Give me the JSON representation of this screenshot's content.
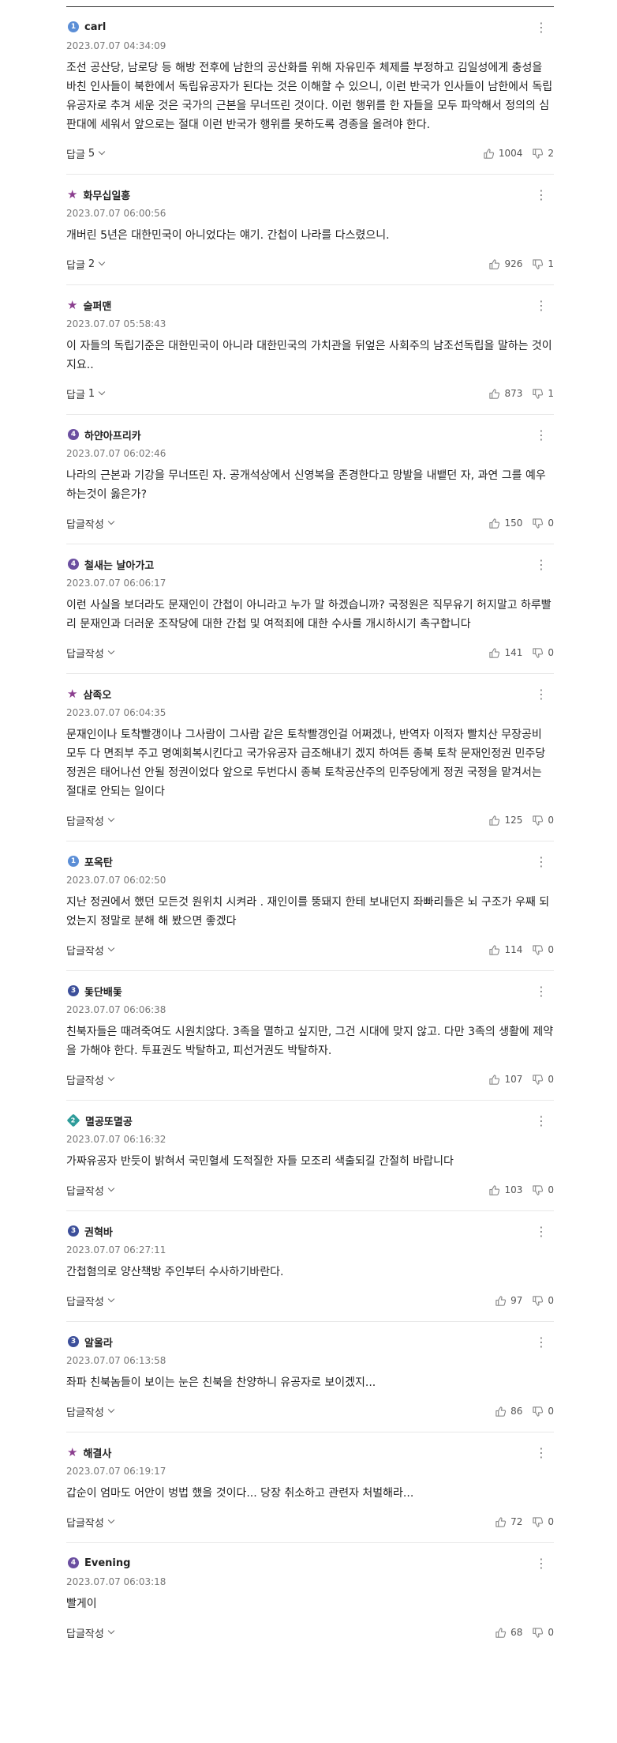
{
  "colors": {
    "badge_blue": "#5b8ed6",
    "badge_purple": "#6b4fa0",
    "badge_navy": "#3c4f9a",
    "badge_teal": "#2e9c9a",
    "star_purple": "#8b3f8f"
  },
  "comments": [
    {
      "author": "carl",
      "badge": {
        "shape": "circle",
        "level": "1",
        "color": "#5b8ed6"
      },
      "date": "2023.07.07 04:34:09",
      "text": "조선 공산당, 남로당 등 해방 전후에 남한의 공산화를 위해 자유민주 체제를 부정하고 김일성에게 충성을 바친 인사들이 북한에서 독립유공자가 된다는 것은 이해할 수 있으니, 이런 반국가 인사들이 남한에서 독립유공자로 추겨 세운 것은 국가의 근본을 무너뜨린 것이다. 이런 행위를 한 자들을 모두 파악해서 정의의 심판대에 세워서 앞으로는 절대 이런 반국가 행위를 못하도록 경종을 올려야 한다.",
      "reply_label": "답글",
      "reply_count": "5",
      "likes": "1004",
      "dislikes": "2"
    },
    {
      "author": "화무십일홍",
      "badge": {
        "shape": "star",
        "level": "5",
        "color": "#8b3f8f"
      },
      "date": "2023.07.07 06:00:56",
      "text": "개버린 5년은 대한민국이 아니었다는 얘기. 간첩이 나라를 다스렸으니.",
      "reply_label": "답글",
      "reply_count": "2",
      "likes": "926",
      "dislikes": "1"
    },
    {
      "author": "술퍼맨",
      "badge": {
        "shape": "star",
        "level": "5",
        "color": "#8b3f8f"
      },
      "date": "2023.07.07 05:58:43",
      "text": "이 자들의 독립기준은 대한민국이 아니라 대한민국의 가치관을 뒤엎은 사회주의 남조선독립을 말하는 것이지요..",
      "reply_label": "답글",
      "reply_count": "1",
      "likes": "873",
      "dislikes": "1"
    },
    {
      "author": "하얀아프리카",
      "badge": {
        "shape": "circle",
        "level": "4",
        "color": "#6b4fa0"
      },
      "date": "2023.07.07 06:02:46",
      "text": "나라의 근본과 기강을 무너뜨린 자. 공개석상에서 신영복을 존경한다고 망발을 내뱉던 자, 과연 그를 예우하는것이 옳은가?",
      "reply_label": "답글작성",
      "reply_count": "",
      "likes": "150",
      "dislikes": "0"
    },
    {
      "author": "철새는 날아가고",
      "badge": {
        "shape": "circle",
        "level": "4",
        "color": "#6b4fa0"
      },
      "date": "2023.07.07 06:06:17",
      "text": "이런 사실을 보더라도 문재인이 간첩이 아니라고 누가 말 하겠습니까? 국정원은 직무유기 허지말고 하루빨리 문재인과 더러운 조작당에 대한 간첩 및 여적죄에 대한 수사를 개시하시기 촉구합니다",
      "reply_label": "답글작성",
      "reply_count": "",
      "likes": "141",
      "dislikes": "0"
    },
    {
      "author": "삼족오",
      "badge": {
        "shape": "star",
        "level": "5",
        "color": "#8b3f8f"
      },
      "date": "2023.07.07 06:04:35",
      "text": "문재인이나 토착빨갱이나 그사람이 그사람 같은 토착빨갱인걸 어쩌겠나, 반역자 이적자 빨치산 무장공비 모두 다 면죄부 주고 명예회복시킨다고 국가유공자 급조해내기 겠지 하여튼 종북 토착 문재인정권 민주당정권은 태어나선 안될 정권이었다 앞으로 두번다시 종북 토착공산주의 민주당에게 정권 국정을 맡겨서는 절대로 안되는 일이다",
      "reply_label": "답글작성",
      "reply_count": "",
      "likes": "125",
      "dislikes": "0"
    },
    {
      "author": "포옥탄",
      "badge": {
        "shape": "circle",
        "level": "1",
        "color": "#5b8ed6"
      },
      "date": "2023.07.07 06:02:50",
      "text": "지난 정권에서 했던 모든것 원위치 시켜라 . 재인이를 뚱돼지 한테 보내던지 좌빠리들은 뇌 구조가 우째 되었는지 정말로 분해 해 봤으면 좋겠다",
      "reply_label": "답글작성",
      "reply_count": "",
      "likes": "114",
      "dislikes": "0"
    },
    {
      "author": "돛단배돛",
      "badge": {
        "shape": "circle",
        "level": "3",
        "color": "#3c4f9a"
      },
      "date": "2023.07.07 06:06:38",
      "text": "친북자들은 때려죽여도 시원치않다. 3족을 멸하고 싶지만, 그건 시대에 맞지 않고. 다만 3족의 생활에 제약을 가해야 한다. 투표권도 박탈하고, 피선거권도 박탈하자.",
      "reply_label": "답글작성",
      "reply_count": "",
      "likes": "107",
      "dislikes": "0"
    },
    {
      "author": "멸공또멸공",
      "badge": {
        "shape": "diamond",
        "level": "2",
        "color": "#2e9c9a"
      },
      "date": "2023.07.07 06:16:32",
      "text": "가짜유공자 반듯이 밝혀서 국민혈세 도적질한 자들 모조리 색출되길 간절히 바랍니다",
      "reply_label": "답글작성",
      "reply_count": "",
      "likes": "103",
      "dislikes": "0"
    },
    {
      "author": "권혁바",
      "badge": {
        "shape": "circle",
        "level": "3",
        "color": "#3c4f9a"
      },
      "date": "2023.07.07 06:27:11",
      "text": "간첩혐의로 양산책방 주인부터 수사하기바란다.",
      "reply_label": "답글작성",
      "reply_count": "",
      "likes": "97",
      "dislikes": "0"
    },
    {
      "author": "알울라",
      "badge": {
        "shape": "circle",
        "level": "3",
        "color": "#3c4f9a"
      },
      "date": "2023.07.07 06:13:58",
      "text": "좌파 친북놈들이 보이는 눈은 친북을 찬양하니 유공자로 보이겠지...",
      "reply_label": "답글작성",
      "reply_count": "",
      "likes": "86",
      "dislikes": "0"
    },
    {
      "author": "해결사",
      "badge": {
        "shape": "star",
        "level": "5",
        "color": "#8b3f8f"
      },
      "date": "2023.07.07 06:19:17",
      "text": "갑순이 엄마도 어안이 벙법 했을 것이다... 당장 취소하고 관련자 처벌해라...",
      "reply_label": "답글작성",
      "reply_count": "",
      "likes": "72",
      "dislikes": "0"
    },
    {
      "author": "Evening",
      "badge": {
        "shape": "circle",
        "level": "4",
        "color": "#6b4fa0"
      },
      "date": "2023.07.07 06:03:18",
      "text": "빨게이",
      "reply_label": "답글작성",
      "reply_count": "",
      "likes": "68",
      "dislikes": "0"
    }
  ]
}
